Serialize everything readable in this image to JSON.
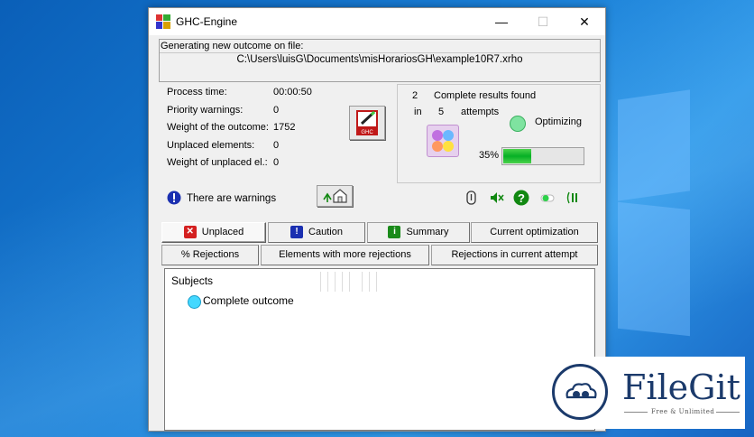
{
  "window": {
    "title": "GHC-Engine",
    "minimize": "—",
    "maximize": "☐",
    "close": "✕"
  },
  "file": {
    "label": "Generating new outcome on file:",
    "path": "C:\\Users\\luisG\\Documents\\misHorariosGH\\example10R7.xrho"
  },
  "stats": [
    {
      "label": "Process time:",
      "value": "00:00:50"
    },
    {
      "label": "Priority warnings:",
      "value": "0"
    },
    {
      "label": "Weight of the outcome:",
      "value": "1752"
    },
    {
      "label": "Unplaced elements:",
      "value": "0"
    },
    {
      "label": "Weight of unplaced el.:",
      "value": "0"
    }
  ],
  "results": {
    "complete_count": "2",
    "complete_label": "Complete results found",
    "in_label": "in",
    "attempts_count": "5",
    "attempts_label": "attempts",
    "status": "Optimizing",
    "progress_label": "35%",
    "progress_fraction": 0.35
  },
  "warning_text": "There are warnings",
  "ghc_button_label": "GHC",
  "tabs_row1": [
    {
      "label": "Unplaced",
      "icon": "x-icon",
      "color": "#d42020"
    },
    {
      "label": "Caution",
      "icon": "exclamation-icon",
      "color": "#1a2fb0"
    },
    {
      "label": "Summary",
      "icon": "info-icon",
      "color": "#1a8a1a"
    },
    {
      "label": "Current optimization"
    }
  ],
  "tabs_row2": [
    {
      "label": "% Rejections"
    },
    {
      "label": "Elements with more rejections"
    },
    {
      "label": "Rejections in current attempt"
    }
  ],
  "panel": {
    "subjects": "Subjects",
    "outcome": "Complete outcome"
  },
  "watermark": {
    "name": "FileGit",
    "tagline": "Free & Unlimited"
  },
  "colors": {
    "accent_green": "#06b025",
    "warn_blue": "#1a2fb0",
    "brand_navy": "#1b3a6b"
  }
}
